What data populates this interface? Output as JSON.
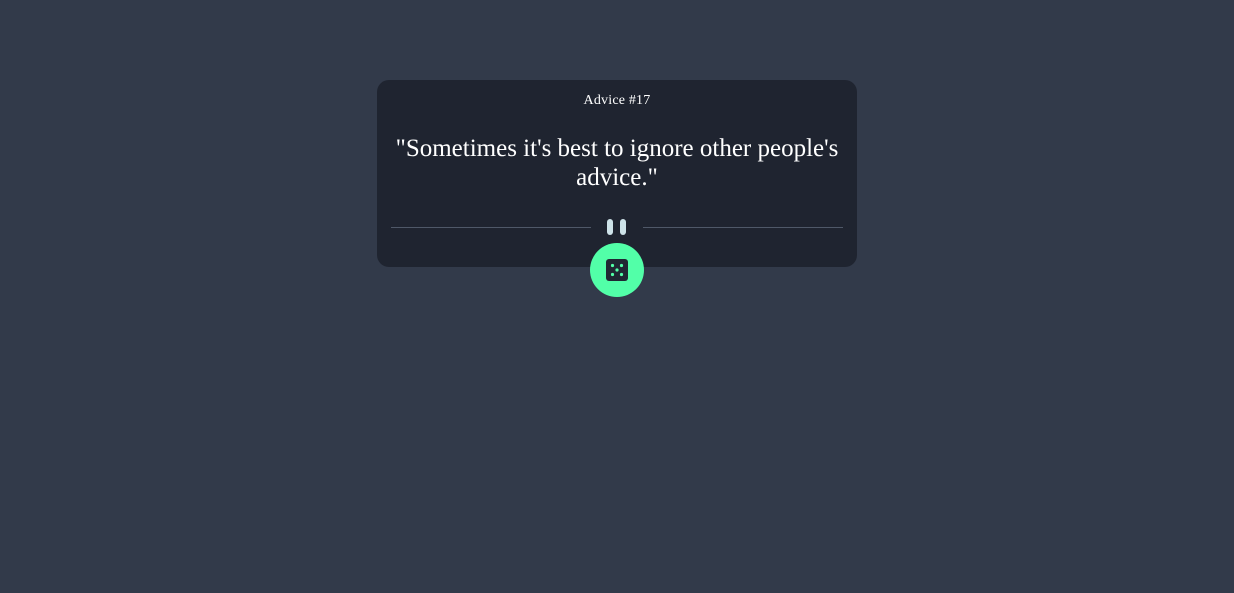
{
  "card": {
    "advice_label": "Advice #17",
    "quote": "\"Sometimes it's best to ignore other people's advice.\""
  },
  "divider": {
    "icon": "pause-icon"
  },
  "button": {
    "icon": "dice-icon"
  },
  "colors": {
    "background": "#323a4a",
    "card": "#1f2430",
    "accent": "#52ffa8",
    "text": "#ffffff",
    "divider_line": "#4f5868",
    "pause_icon": "#cee3e9"
  }
}
